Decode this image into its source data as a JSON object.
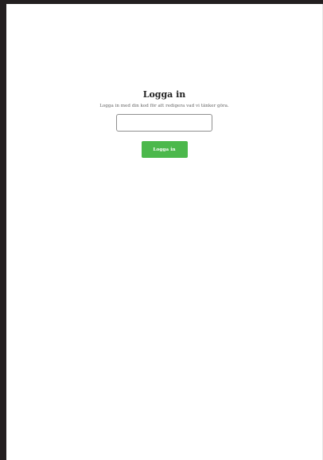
{
  "login": {
    "title": "Logga in",
    "subtitle": "Logga in med din kod för att redigera vad vi tänker göra.",
    "code_input": {
      "value": "",
      "placeholder": ""
    },
    "button_label": "Logga in"
  },
  "colors": {
    "button": "#4cb84c",
    "border": "#8f8f8f",
    "outer_background": "#231f20"
  }
}
